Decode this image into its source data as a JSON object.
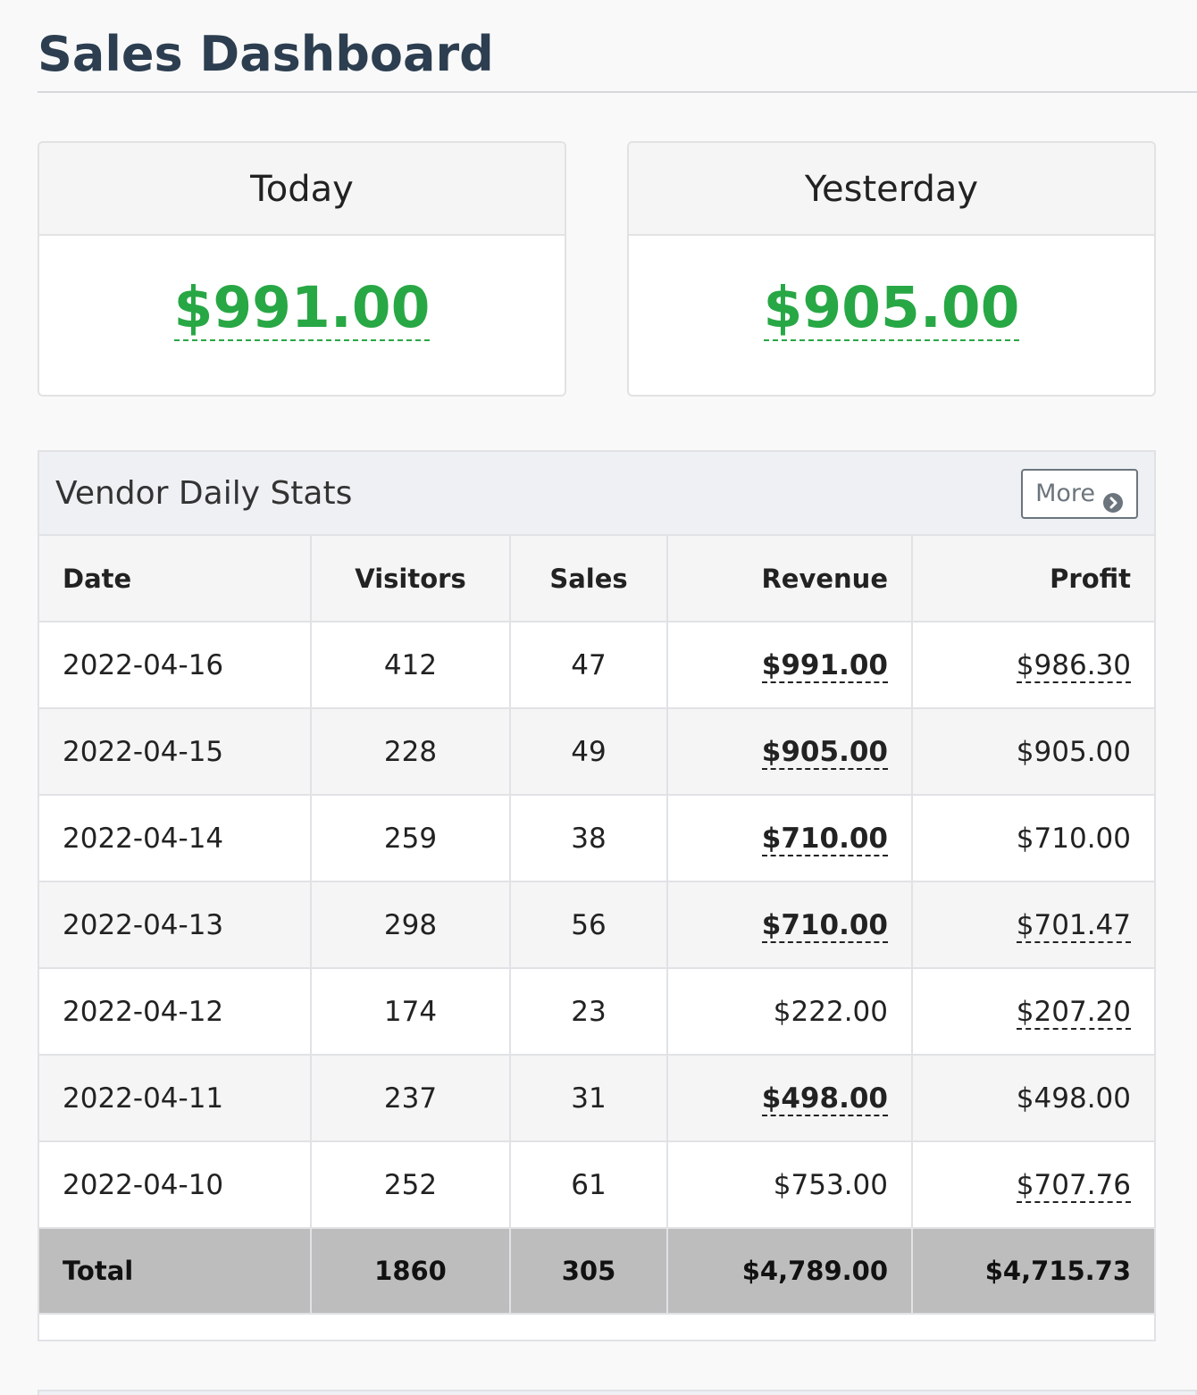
{
  "page": {
    "title": "Sales Dashboard"
  },
  "cards": {
    "today": {
      "label": "Today",
      "amount": "$991.00"
    },
    "yesterday": {
      "label": "Yesterday",
      "amount": "$905.00"
    }
  },
  "vendor_stats": {
    "title": "Vendor Daily Stats",
    "more_label": "More",
    "columns": [
      "Date",
      "Visitors",
      "Sales",
      "Revenue",
      "Profit"
    ],
    "rows": [
      {
        "date": "2022-04-16",
        "visitors": "412",
        "sales": "47",
        "revenue": "$991.00",
        "profit": "$986.30"
      },
      {
        "date": "2022-04-15",
        "visitors": "228",
        "sales": "49",
        "revenue": "$905.00",
        "profit": "$905.00"
      },
      {
        "date": "2022-04-14",
        "visitors": "259",
        "sales": "38",
        "revenue": "$710.00",
        "profit": "$710.00"
      },
      {
        "date": "2022-04-13",
        "visitors": "298",
        "sales": "56",
        "revenue": "$710.00",
        "profit": "$701.47"
      },
      {
        "date": "2022-04-12",
        "visitors": "174",
        "sales": "23",
        "revenue": "$222.00",
        "profit": "$207.20"
      },
      {
        "date": "2022-04-11",
        "visitors": "237",
        "sales": "31",
        "revenue": "$498.00",
        "profit": "$498.00"
      },
      {
        "date": "2022-04-10",
        "visitors": "252",
        "sales": "61",
        "revenue": "$753.00",
        "profit": "$707.76"
      }
    ],
    "total": {
      "label": "Total",
      "visitors": "1860",
      "sales": "305",
      "revenue": "$4,789.00",
      "profit": "$4,715.73"
    }
  },
  "colors": {
    "title": "#2c3e50",
    "amount_green": "#28a745",
    "total_row_bg": "#bdbdbd",
    "button_gray": "#6c757d"
  },
  "icons": {
    "more_button_icon": "chevron-circle-right-icon"
  }
}
